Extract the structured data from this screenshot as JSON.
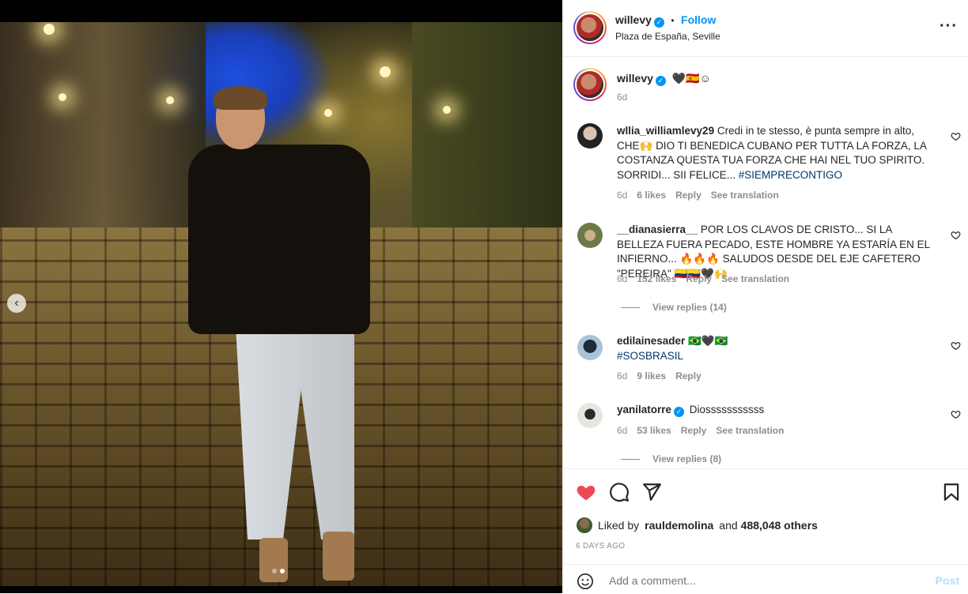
{
  "post": {
    "username": "willevy",
    "follow_label": "Follow",
    "separator": "•",
    "location": "Plaza de España, Seville",
    "more_label": "···",
    "caption": {
      "username": "willevy",
      "text": "🖤🇪🇸☺",
      "time": "6d"
    }
  },
  "comments": [
    {
      "username": "wllia_williamlevy29",
      "verified": false,
      "text": "Credi in te stesso, è punta sempre in alto, CHE🙌 DIO TI BENEDICA CUBANO PER TUTTA LA FORZA, LA COSTANZA QUESTA TUA FORZA CHE HAI NEL TUO SPIRITO. SORRIDI... SII FELICE... ",
      "hashtag": "#SIEMPRECONTIGO",
      "time": "6d",
      "likes": "6 likes",
      "reply": "Reply",
      "translate": "See translation"
    },
    {
      "username": "__dianasierra__",
      "verified": false,
      "text": "POR LOS CLAVOS DE CRISTO... SI LA BELLEZA FUERA PECADO, ESTE HOMBRE YA ESTARÍA EN EL INFIERNO... 🔥🔥🔥 SALUDOS DESDE DEL EJE CAFETERO \"PEREIRA\" 🇨🇴🇨🇴🖤🙌",
      "time": "6d",
      "likes": "152 likes",
      "reply": "Reply",
      "translate": "See translation",
      "view_replies": "View replies (14)"
    },
    {
      "username": "edilainesader",
      "verified": false,
      "text": "🇧🇷🖤🇧🇷",
      "hashtag": "#SOSBRASIL",
      "time": "6d",
      "likes": "9 likes",
      "reply": "Reply"
    },
    {
      "username": "yanilatorre",
      "verified": true,
      "text": "Diosssssssssss",
      "time": "6d",
      "likes": "53 likes",
      "reply": "Reply",
      "translate": "See translation",
      "view_replies": "View replies (8)"
    }
  ],
  "actions": {
    "liked_by_prefix": "Liked by",
    "liked_by_user": "raul­demolina",
    "liked_by_and": "and",
    "liked_by_count": "488,048 others",
    "posted": "6 DAYS AGO",
    "comment_placeholder": "Add a comment...",
    "post_label": "Post"
  },
  "carousel": {
    "current_index": 2,
    "total": 2
  },
  "colors": {
    "accent": "#0095f6",
    "like": "#ed4956",
    "muted": "#8e8e8e"
  }
}
